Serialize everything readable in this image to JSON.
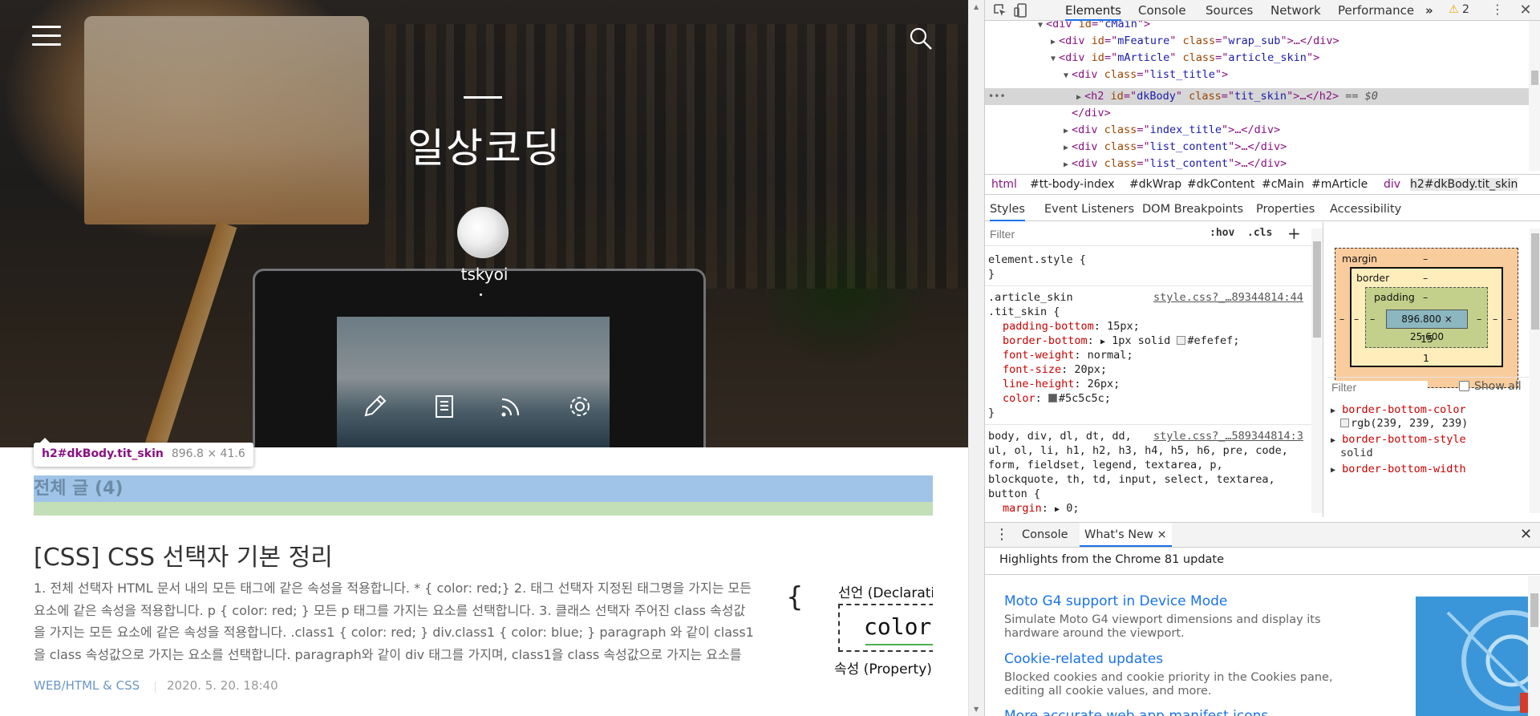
{
  "blog": {
    "title": "일상코딩",
    "username": "tskyoi",
    "list_title": "전체 글 (4)",
    "post": {
      "title": "[CSS] CSS 선택자 기본 정리",
      "excerpt": "1. 전체 선택자 HTML 문서 내의 모든 태그에 같은 속성을 적용합니다. * { color: red;} 2. 태그 선택자 지정된 태그명을 가지는 모든 요소에 같은 속성을 적용합니다. p { color: red; } 모든 p 태그를 가지는 요소를 선택합니다. 3. 클래스 선택자 주어진 class 속성값을 가지는 모든 요소에 같은 속성을 적용합니다. .class1 { color: red; } div.class1 { color: blue; } paragraph 와 같이 class1을 class 속성값으로 가지는 요소를 선택합니다. paragraph와 같이 div 태그를 가지며, class1을 class 속성값으로 가지는 요소를 선택합니다. paragra…",
      "category": "WEB/HTML & CSS",
      "date": "2020. 5. 20. 18:40",
      "thumb_brace": "{",
      "thumb_declaration": "선언 (Declaratio",
      "thumb_color": "color",
      "thumb_property": "속성 (Property)"
    },
    "tooltip": {
      "selector": "h2#dkBody.tit_skin",
      "size": "896.8 × 41.6"
    },
    "icons": {
      "menu": "hamburger-menu-icon",
      "search": "search-icon",
      "write": "pencil-icon",
      "guestbook": "notebook-icon",
      "rss": "rss-icon",
      "settings": "gear-icon"
    }
  },
  "devtools": {
    "tabs": [
      "Elements",
      "Console",
      "Sources",
      "Network",
      "Performance"
    ],
    "more_tabs": "»",
    "warning_count": "2",
    "dom": {
      "l1": {
        "open": "<div ",
        "attrs": [
          [
            "id",
            "cMain"
          ]
        ],
        "close": ">"
      },
      "l2": {
        "attrs": [
          [
            "id",
            "mFeature"
          ],
          [
            "class",
            "wrap_sub"
          ]
        ],
        "tail": "…</div>"
      },
      "l3": {
        "attrs": [
          [
            "id",
            "mArticle"
          ],
          [
            "class",
            "article_skin"
          ]
        ]
      },
      "l4": {
        "attrs": [
          [
            "class",
            "list_title"
          ]
        ]
      },
      "l5": {
        "attrs": [
          [
            "id",
            "dkBody"
          ],
          [
            "class",
            "tit_skin"
          ]
        ],
        "tail": "…</h2>",
        "eq": "== $0"
      },
      "l6": "</div>",
      "l7": {
        "attrs": [
          [
            "class",
            "index_title"
          ]
        ],
        "tail": "…</div>"
      },
      "l8": {
        "attrs": [
          [
            "class",
            "list_content"
          ]
        ],
        "tail": "…</div>"
      },
      "l9": {
        "attrs": [
          [
            "class",
            "list_content"
          ]
        ],
        "tail": "…</div>"
      },
      "dots": "•••"
    },
    "breadcrumbs": [
      "html",
      "#tt-body-index",
      "#dkWrap",
      "#dkContent",
      "#cMain",
      "#mArticle",
      "div",
      "h2#dkBody.tit_skin"
    ],
    "subtabs": [
      "Styles",
      "Event Listeners",
      "DOM Breakpoints",
      "Properties",
      "Accessibility"
    ],
    "styles": {
      "filter_placeholder": "Filter",
      "hov": ":hov",
      "cls": ".cls",
      "plus": "+",
      "element_style": "element.style {",
      "close_brace": "}",
      "rule1": {
        "selector_1": ".article_skin",
        "selector_2": ".tit_skin {",
        "source": "style.css?_…89344814:44",
        "decls": [
          [
            "padding-bottom",
            "15px;"
          ],
          [
            "border-bottom",
            "1px solid",
            "#efefef;"
          ],
          [
            "font-weight",
            "normal;"
          ],
          [
            "font-size",
            "20px;"
          ],
          [
            "line-height",
            "26px;"
          ],
          [
            "color",
            "#5c5c5c;"
          ]
        ],
        "swatch_1": "#efefef",
        "swatch_2": "#5c5c5c"
      },
      "rule2": {
        "sel_line1": "body, div, dl, dt, dd,",
        "source": "style.css?_…589344814:3",
        "sel_line2": "ul, ol, li, h1, h2, h3, h4, h5, h6, pre, code,",
        "sel_line3": "form, fieldset, legend, textarea, p,",
        "sel_line4": "blockquote, th, td, input, select, textarea,",
        "sel_line5": "button {",
        "decl_prop": "margin",
        "decl_val": "0;"
      }
    },
    "box_model": {
      "margin_label": "margin",
      "border_label": "border",
      "padding_label": "padding",
      "dash": "–",
      "content": "896.800 × 25.600",
      "padding_bottom": "15",
      "border_bottom": "1"
    },
    "computed": {
      "filter_placeholder": "Filter",
      "show_all": "Show all",
      "items": [
        [
          "border-bottom-color",
          "rgb(239, 239, 239)"
        ],
        [
          "border-bottom-style",
          "solid"
        ],
        [
          "border-bottom-width",
          ""
        ]
      ],
      "swatch": "#efefef"
    },
    "drawer": {
      "tabs": [
        "Console",
        "What's New"
      ],
      "close": "×",
      "heading": "Highlights from the Chrome 81 update",
      "items": [
        {
          "title": "Moto G4 support in Device Mode",
          "desc": "Simulate Moto G4 viewport dimensions and display its hardware around the viewport."
        },
        {
          "title": "Cookie-related updates",
          "desc": "Blocked cookies and cookie priority in the Cookies pane, editing all cookie values, and more."
        },
        {
          "title": "More accurate web app manifest icons",
          "desc": ""
        }
      ]
    },
    "colors": {
      "accent": "#1a73e8",
      "tag": "#881280",
      "attr_name": "#994500",
      "attr_value": "#1a1aa6",
      "prop": "#c80000"
    }
  }
}
